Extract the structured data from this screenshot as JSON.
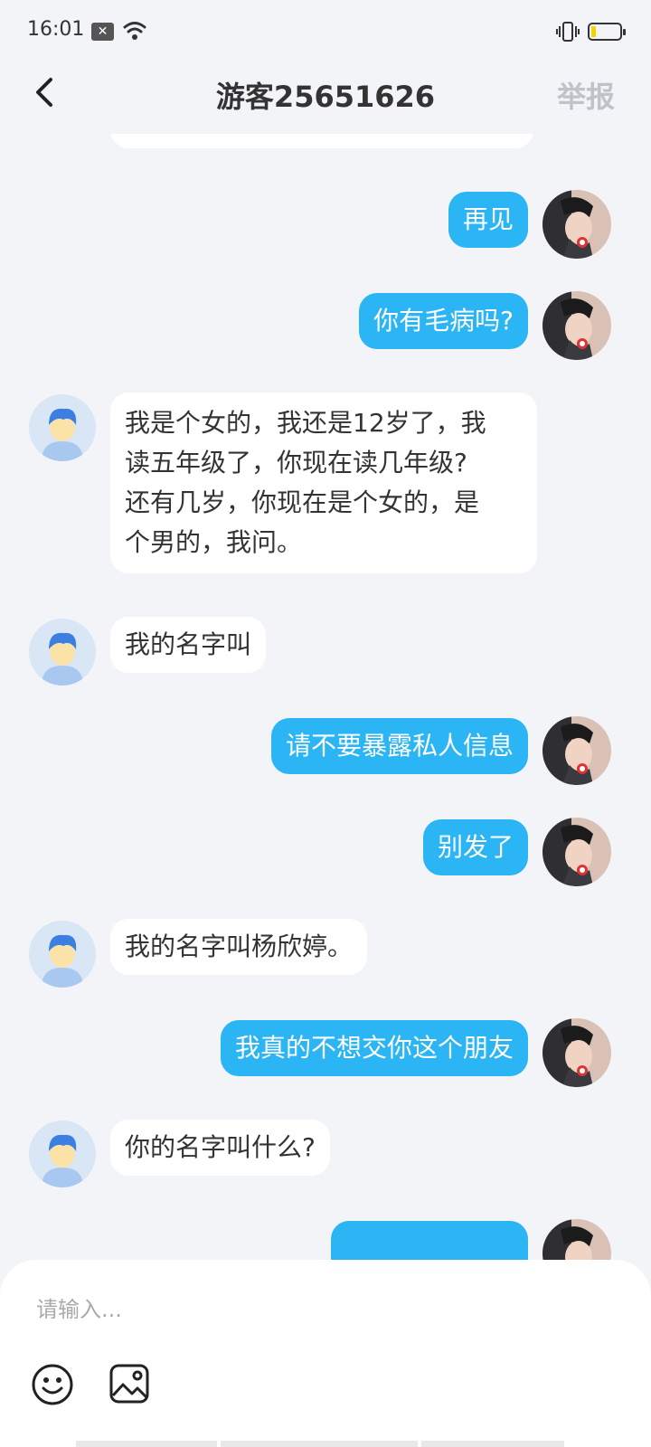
{
  "status": {
    "time": "16:01"
  },
  "header": {
    "title": "游客25651626",
    "report_label": "举报"
  },
  "messages": [
    {
      "side": "in",
      "text": ""
    },
    {
      "side": "out",
      "text": "再见"
    },
    {
      "side": "out",
      "text": "你有毛病吗?"
    },
    {
      "side": "in",
      "lines": [
        "我是个女的，我还是12岁了，我",
        "读五年级了，你现在读几年级?",
        "还有几岁，你现在是个女的，是",
        "个男的，我问。"
      ]
    },
    {
      "side": "in",
      "text": "我的名字叫"
    },
    {
      "side": "out",
      "text": "请不要暴露私人信息"
    },
    {
      "side": "out",
      "text": "别发了"
    },
    {
      "side": "in",
      "text": "我的名字叫杨欣婷。"
    },
    {
      "side": "out",
      "text": "我真的不想交你这个朋友"
    },
    {
      "side": "in",
      "text": "你的名字叫什么?"
    },
    {
      "side": "out",
      "text": ""
    }
  ],
  "input": {
    "placeholder": "请输入..."
  },
  "icons": {
    "emoji": "smiley-icon",
    "image": "image-icon",
    "back": "chevron-left-icon"
  },
  "colors": {
    "outgoing_bubble": "#2bb5f4",
    "incoming_bubble": "#ffffff",
    "background": "#f2f4f7",
    "report": "#bfc3c9"
  }
}
